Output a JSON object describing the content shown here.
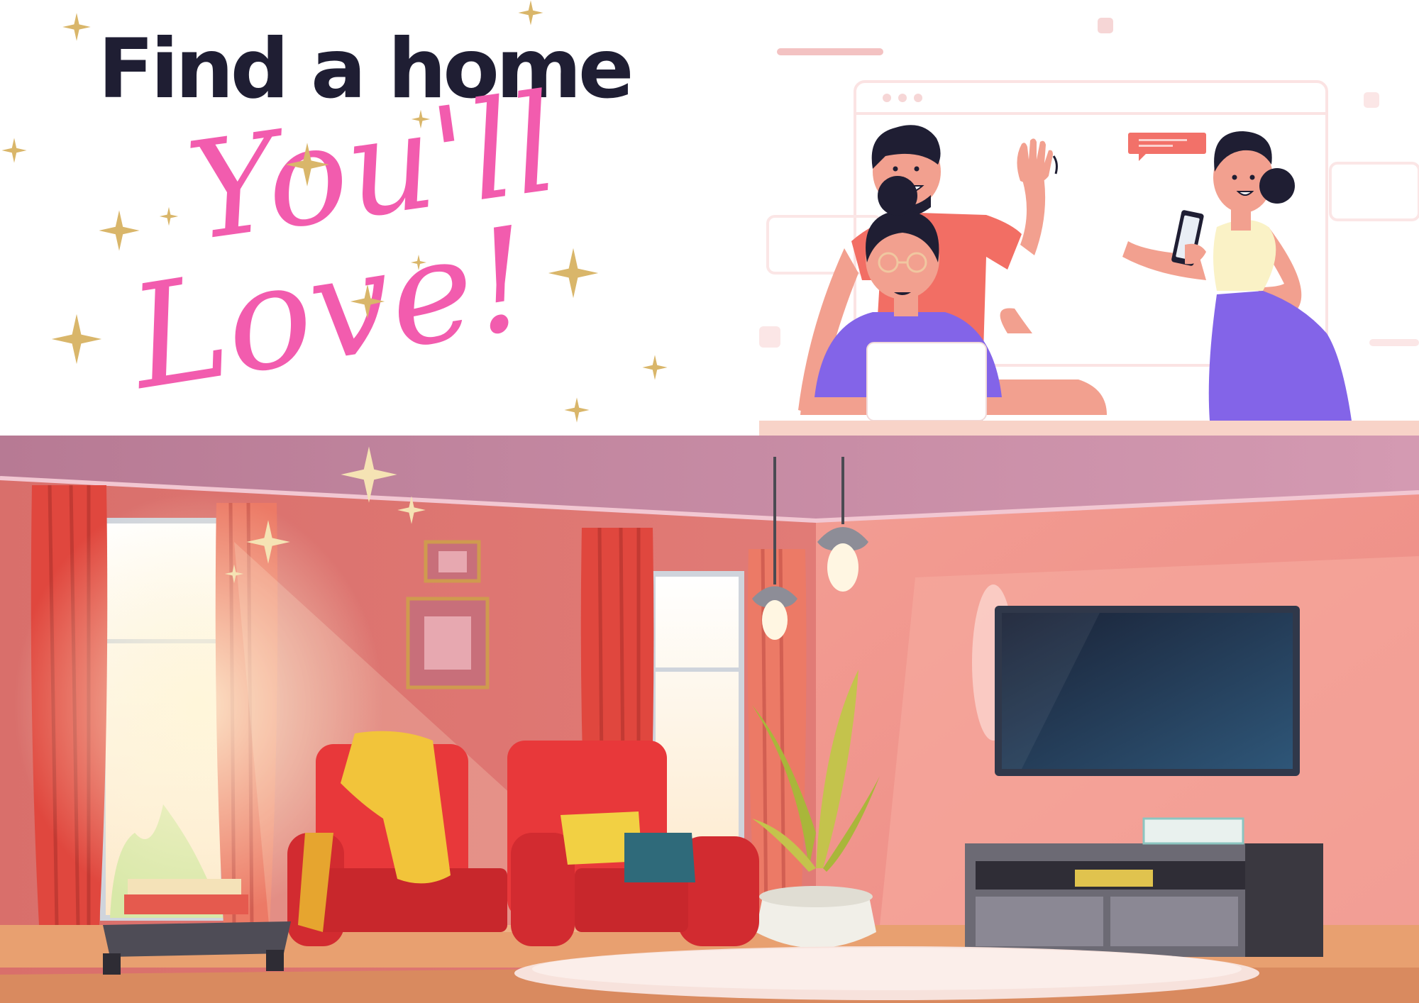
{
  "banner": {
    "headline": "Find a home",
    "script_line_1": "You'll",
    "script_line_2": "Love!"
  },
  "colors": {
    "headline": "#1f1e33",
    "script": "#f25cae",
    "sparkle": "#d9b66a",
    "wall": "#ec8c86",
    "ceiling": "#c98ba6",
    "armchair": "#e8383a",
    "tv_screen": "#1f3655",
    "floor": "#d98a5f"
  },
  "icons": [
    "sparkle-icon",
    "chat-bubble-icon",
    "smartphone-icon",
    "laptop-icon",
    "pendant-lamp-icon"
  ]
}
